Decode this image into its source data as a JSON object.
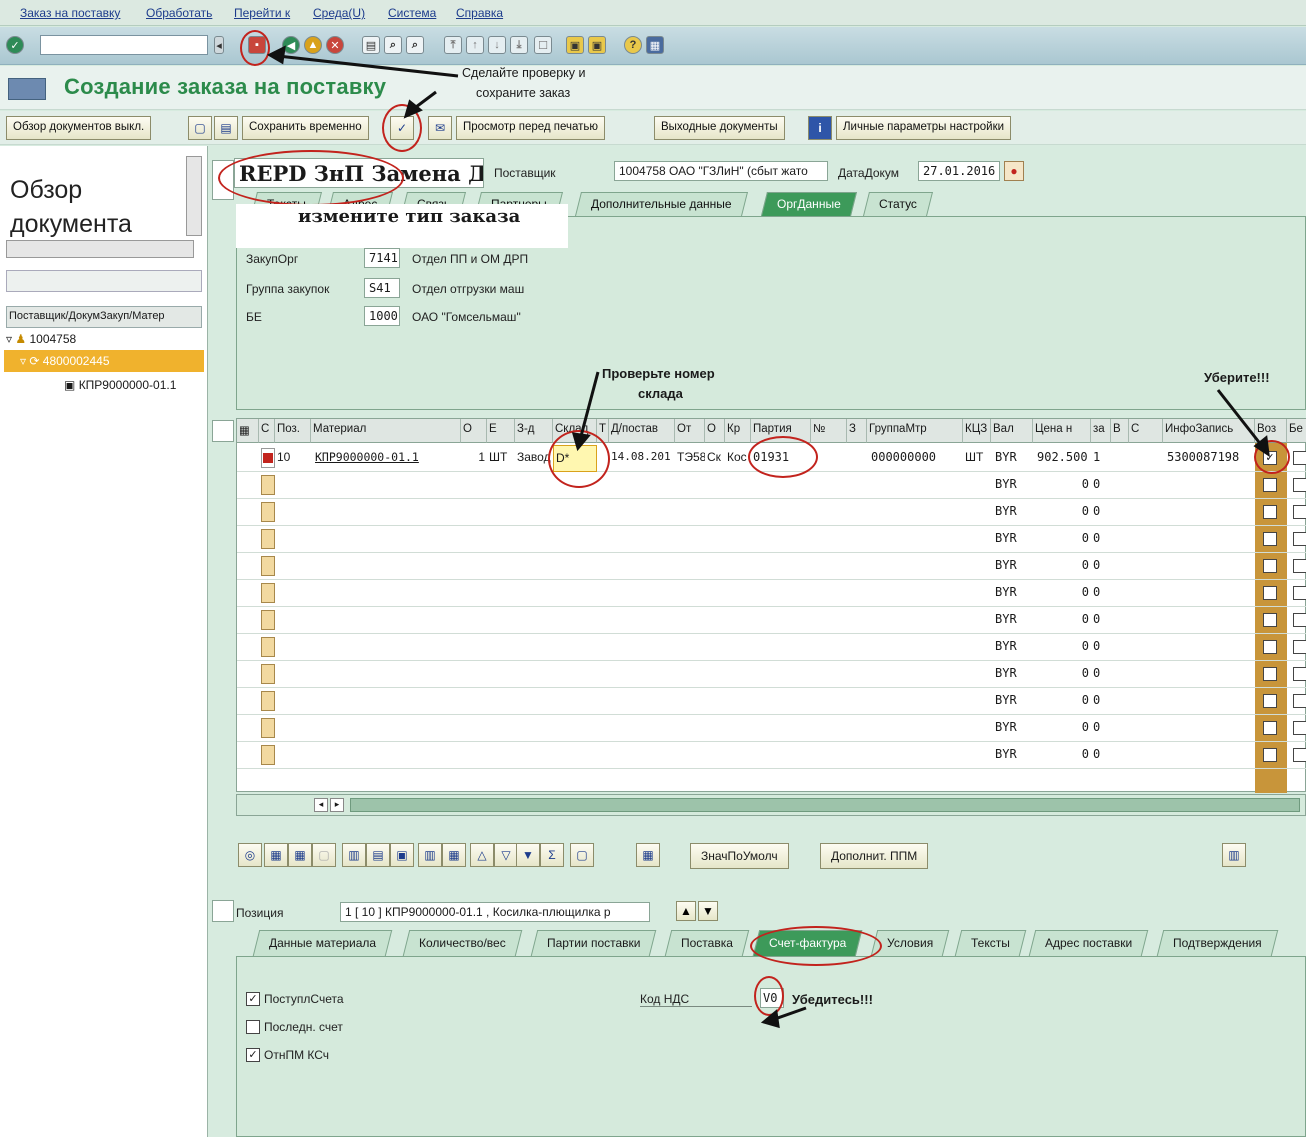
{
  "menu": [
    "Заказ на поставку",
    "Обработать",
    "Перейти к",
    "Среда(U)",
    "Система",
    "Справка"
  ],
  "toolbar": {
    "command_value": ""
  },
  "title": "Создание заказа на поставку",
  "app_toolbar": {
    "overview_button": "Обзор документов выкл.",
    "save_temp_button": "Сохранить временно",
    "preview_button": "Просмотр перед печатью",
    "output_button": "Выходные документы",
    "personal_settings_button": "Личные параметры настройки"
  },
  "left_pane": {
    "heading_line1": "Обзор",
    "heading_line2": "документа",
    "column_header": "Поставщик/ДокумЗакуп/Матер",
    "tree": [
      {
        "label": "1004758"
      },
      {
        "label": "4800002445"
      },
      {
        "label": "КПР9000000-01.1"
      }
    ]
  },
  "header": {
    "order_type": "REPD ЗнП Замена Дав",
    "vendor_label": "Поставщик",
    "vendor_value": "1004758 ОАО \"ГЗЛиН\" (сбыт жато",
    "doc_date_label": "ДатаДокум",
    "doc_date_value": "27.01.2016",
    "tabs": [
      "Тексты",
      "Адрес",
      "Связь",
      "Партнеры",
      "Дополнительные данные",
      "ОргДанные",
      "Статус"
    ],
    "active_tab": "ОргДанные",
    "org": [
      {
        "label": "ЗакупОрг",
        "code": "7141",
        "text": "Отдел ПП и ОМ ДРП"
      },
      {
        "label": "Группа закупок",
        "code": "S41",
        "text": "Отдел отгрузки маш"
      },
      {
        "label": "БЕ",
        "code": "1000",
        "text": "ОАО \"Гомсельмаш\""
      }
    ]
  },
  "grid": {
    "columns": [
      "С",
      "Поз.",
      "Материал",
      "О",
      "Е",
      "З-д",
      "Склад",
      "Т",
      "Д/постав",
      "От",
      "О",
      "Кр",
      "Партия",
      "№",
      "З",
      "ГруппаМтр",
      "КЦЗ",
      "Вал",
      "Цена н",
      "за",
      "В",
      "С",
      "ИнфоЗапись",
      "Воз",
      "Бе"
    ],
    "row1": {
      "pos": "10",
      "material": "КПР9000000-01.1",
      "qty": "1",
      "unit": "ШТ",
      "plant": "Завод",
      "storage": "D*",
      "date": "14.08.201",
      "from": "ТЭ58",
      "o": "Ск",
      "kr": "Кос",
      "batch": "01931",
      "matgroup": "000000000",
      "uom": "ШТ",
      "currency": "BYR",
      "price": "902.500",
      "per": "1",
      "inforecord": "5300087198",
      "return_flag": "✓"
    },
    "currency_default": "BYR",
    "price_default": "0",
    "per_default": "0"
  },
  "bottom_toolbar": {
    "default_values_button": "ЗначПоУмолч",
    "extra_button": "Дополнит. ППМ"
  },
  "item": {
    "label": "Позиция",
    "value": "1 [ 10 ] КПР9000000-01.1 , Косилка-плющилка р",
    "tabs": [
      "Данные материала",
      "Количество/вес",
      "Партии поставки",
      "Поставка",
      "Счет-фактура",
      "Условия",
      "Тексты",
      "Адрес поставки",
      "Подтверждения"
    ],
    "active_tab": "Счет-фактура",
    "checks": [
      {
        "label": "ПоступлСчета",
        "checked": true
      },
      {
        "label": "Последн. счет",
        "checked": false
      },
      {
        "label": "ОтнПМ КСч",
        "checked": true
      }
    ],
    "tax_label": "Код НДС",
    "tax_value": "V0"
  },
  "annotations": {
    "save_hint_line1": "Сделайте проверку и",
    "save_hint_line2": "сохраните заказ",
    "type_hint": "измените тип заказа",
    "storage_hint_line1": "Проверьте номер",
    "storage_hint_line2": "склада",
    "remove_hint": "Уберите!!!",
    "tax_hint": "Убедитесь!!!"
  },
  "colors": {
    "accent": "#3d9a5a",
    "annotation": "#c2231d"
  }
}
